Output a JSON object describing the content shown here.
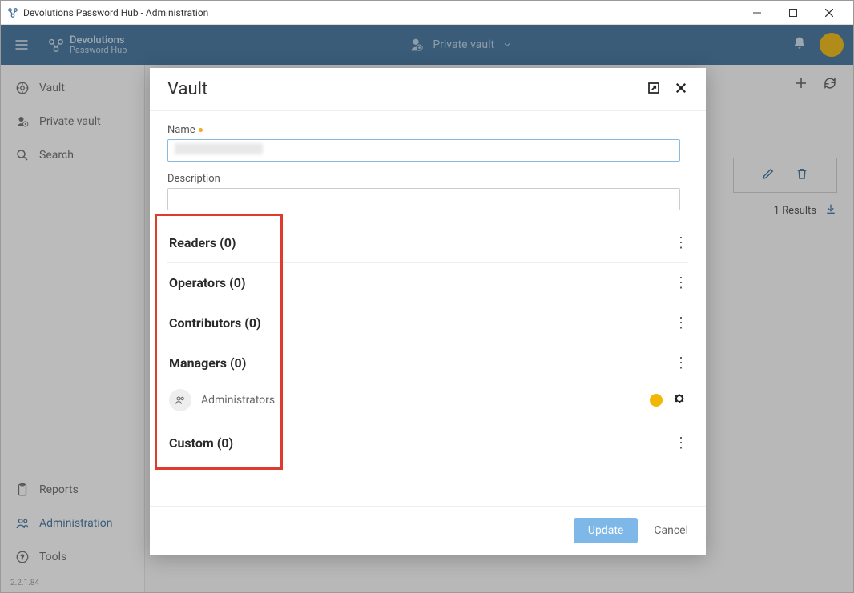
{
  "window": {
    "title": "Devolutions Password Hub - Administration"
  },
  "brand": {
    "line1": "Devolutions",
    "line2": "Password Hub"
  },
  "topnav": {
    "center_label": "Private vault"
  },
  "sidebar": {
    "items": [
      {
        "label": "Vault"
      },
      {
        "label": "Private vault"
      },
      {
        "label": "Search"
      }
    ],
    "bottom_items": [
      {
        "label": "Reports"
      },
      {
        "label": "Administration"
      },
      {
        "label": "Tools"
      }
    ],
    "version": "2.2.1.84"
  },
  "main": {
    "results": "1 Results"
  },
  "modal": {
    "title": "Vault",
    "name_label": "Name",
    "description_label": "Description",
    "roles": [
      {
        "title": "Readers (0)"
      },
      {
        "title": "Operators (0)"
      },
      {
        "title": "Contributors (0)"
      },
      {
        "title": "Managers (0)",
        "members": [
          {
            "name": "Administrators"
          }
        ]
      },
      {
        "title": "Custom (0)"
      }
    ],
    "update_label": "Update",
    "cancel_label": "Cancel"
  }
}
